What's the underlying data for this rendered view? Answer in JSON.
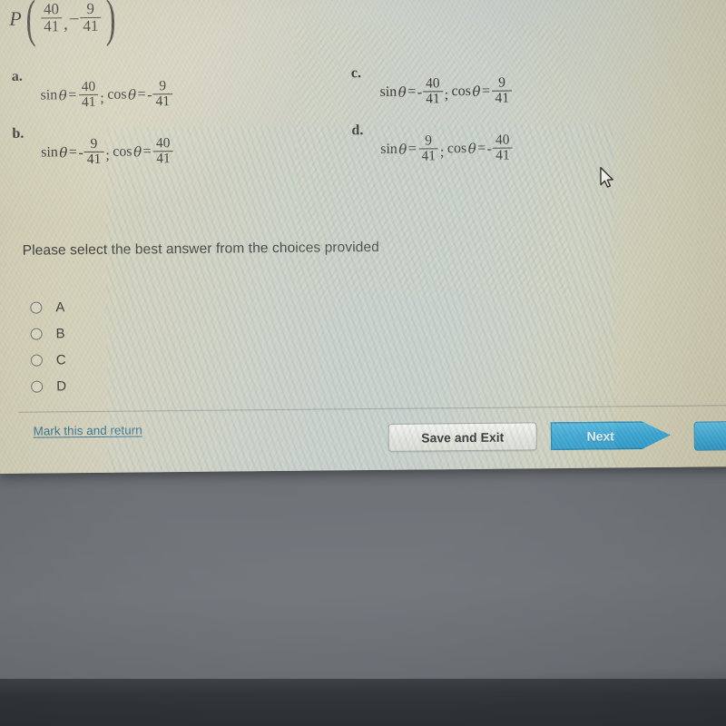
{
  "question": {
    "point_label": "P",
    "point_x_num": "40",
    "point_x_den": "41",
    "point_y_sign": "–",
    "point_y_num": "9",
    "point_y_den": "41",
    "comma": ",",
    "sin_label": "sin",
    "cos_label": "cos",
    "theta": "θ",
    "equals": "=",
    "semicolon": ";",
    "minus": "-"
  },
  "choices": [
    {
      "letter": "a.",
      "sin_sign": "",
      "sin_num": "40",
      "sin_den": "41",
      "cos_sign": "-",
      "cos_num": "9",
      "cos_den": "41"
    },
    {
      "letter": "b.",
      "sin_sign": "-",
      "sin_num": "9",
      "sin_den": "41",
      "cos_sign": "",
      "cos_num": "40",
      "cos_den": "41"
    },
    {
      "letter": "c.",
      "sin_sign": "-",
      "sin_num": "40",
      "sin_den": "41",
      "cos_sign": "",
      "cos_num": "9",
      "cos_den": "41"
    },
    {
      "letter": "d.",
      "sin_sign": "",
      "sin_num": "9",
      "sin_den": "41",
      "cos_sign": "-",
      "cos_num": "40",
      "cos_den": "41"
    }
  ],
  "instruction": "Please select the best answer from the choices provided",
  "answer_options": [
    {
      "label": "A",
      "selected": false
    },
    {
      "label": "B",
      "selected": false
    },
    {
      "label": "C",
      "selected": false
    },
    {
      "label": "D",
      "selected": false
    }
  ],
  "toolbar": {
    "mark_link": "Mark this and return",
    "save_button": "Save and Exit",
    "next_button": "Next"
  },
  "colors": {
    "screen_beige": "#d3cfb2",
    "screen_gray_green": "#c9cfc8",
    "next_blue": "#3aa6d2",
    "link_blue": "#39738f",
    "bezel_gray": "#6d7176",
    "text_dark": "#2b2c29"
  }
}
